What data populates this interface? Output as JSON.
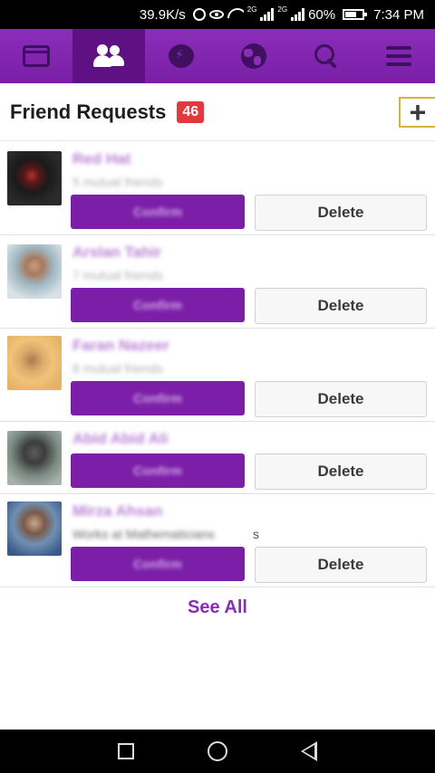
{
  "status_bar": {
    "speed": "39.9K/s",
    "network_tag_1": "2G",
    "network_tag_2": "2G",
    "battery": "60%",
    "time": "7:34 PM"
  },
  "nav": {
    "tabs": [
      {
        "icon": "news-feed-icon",
        "active": false
      },
      {
        "icon": "friends-icon",
        "active": true
      },
      {
        "icon": "messenger-icon",
        "active": false
      },
      {
        "icon": "globe-icon",
        "active": false
      },
      {
        "icon": "search-icon",
        "active": false
      },
      {
        "icon": "menu-icon",
        "active": false
      }
    ]
  },
  "header": {
    "title": "Friend Requests",
    "badge": "46",
    "add_icon": "plus-icon"
  },
  "requests": [
    {
      "name": "Red Hat",
      "subtext": "5 mutual friends",
      "confirm": "Confirm",
      "delete": "Delete"
    },
    {
      "name": "Arslan Tahir",
      "subtext": "7 mutual friends",
      "confirm": "Confirm",
      "delete": "Delete"
    },
    {
      "name": "Faran Nazeer",
      "subtext": "8 mutual friends",
      "confirm": "Confirm",
      "delete": "Delete"
    },
    {
      "name": "Abid Abid Ali",
      "subtext": "",
      "confirm": "Confirm",
      "delete": "Delete"
    },
    {
      "name": "Mirza Ahsan",
      "subtext": "Works at Mathematicians",
      "subtext_tail": "s",
      "confirm": "Confirm",
      "delete": "Delete"
    }
  ],
  "see_all": "See All",
  "colors": {
    "brand": "#8a2db8",
    "active_tab": "#5f1184",
    "confirm": "#7b1fa8",
    "badge": "#e0393e"
  }
}
